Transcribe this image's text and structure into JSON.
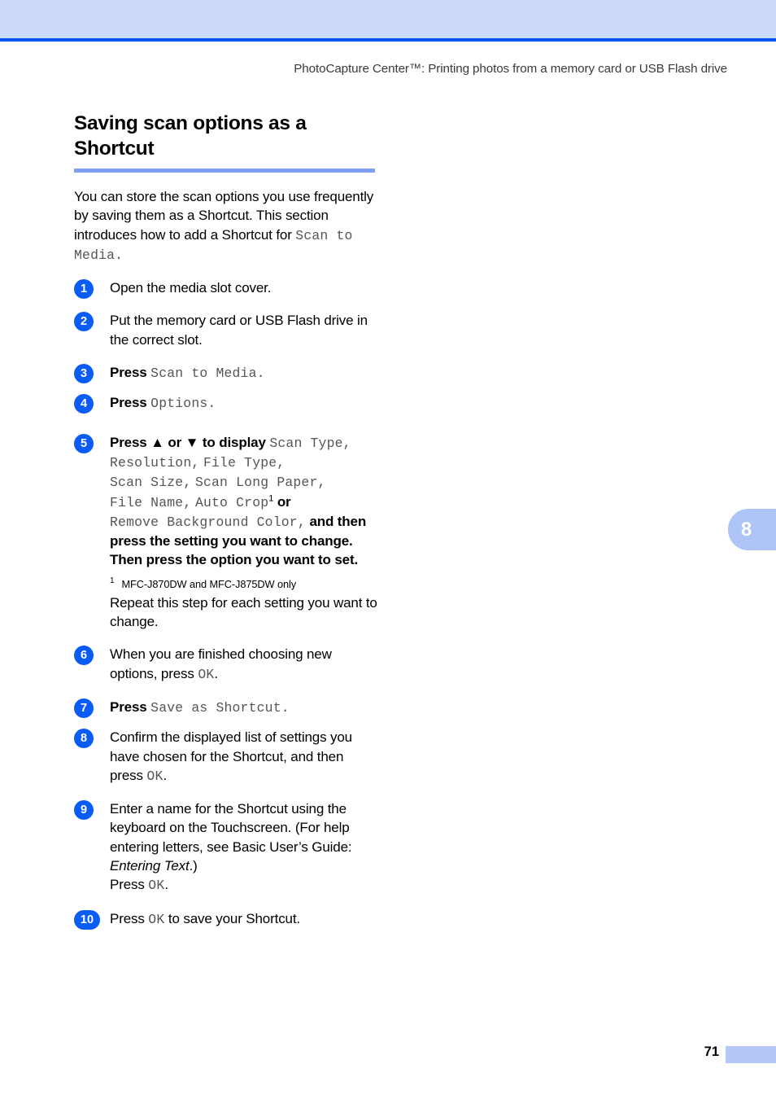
{
  "header": {
    "running_head": "PhotoCapture Center™: Printing photos from a memory card or USB Flash drive",
    "band_color": "#ccd9fb",
    "rule_color": "#0055f0"
  },
  "section": {
    "title": "Saving scan options as a Shortcut",
    "rule_color": "#7e9ff4",
    "intro_text_1": "You can store the scan options you use frequently by saving them as a Shortcut. This section introduces how to add a Shortcut for ",
    "intro_lcd": "Scan to Media."
  },
  "steps": [
    {
      "number": "1",
      "text": "Open the media slot cover."
    },
    {
      "number": "2",
      "text": "Put the memory card or USB Flash drive in the correct slot."
    },
    {
      "number": "3",
      "press_label": "Press",
      "lcd": "Scan to Media."
    },
    {
      "number": "4",
      "press_label": "Press",
      "lcd": "Options."
    },
    {
      "number": "5",
      "lead": "Press ▲ or ▼ to display ",
      "lcd_items": [
        "Scan Type,",
        "Resolution,",
        "File Type,",
        "Scan Size,",
        "Scan Long Paper,",
        "File Name,",
        "Auto Crop",
        "Remove Background Color,"
      ],
      "footnote_marker": "1",
      "or_word": "or",
      "tail": "and then press the setting you want to change. Then press the option you want to set.",
      "footnote_number": "1",
      "footnote_text": "MFC-J870DW and MFC-J875DW only",
      "after_note": "Repeat this step for each setting you want to change."
    },
    {
      "number": "6",
      "text_before": "When you are finished choosing new options, press ",
      "lcd": "OK",
      "text_after": "."
    },
    {
      "number": "7",
      "press_label": "Press",
      "lcd": "Save as Shortcut."
    },
    {
      "number": "8",
      "text_before": "Confirm the displayed list of settings you have chosen for the Shortcut, and then press ",
      "lcd": "OK",
      "text_after": "."
    },
    {
      "number": "9",
      "text_before": "Enter a name for the Shortcut using the keyboard on the Touchscreen. (For help entering letters, see Basic User’s Guide: ",
      "italic": "Entering Text",
      "text_after": ".)",
      "press_line_label": "Press ",
      "press_line_lcd": "OK",
      "press_line_end": "."
    },
    {
      "number": "10",
      "press_label": "Press ",
      "lcd": "OK",
      "text_after": " to save your Shortcut."
    }
  ],
  "chapter_tab": {
    "number": "8",
    "color": "#aec4f6"
  },
  "footer": {
    "page_number": "71",
    "block_color": "#b4c8f7"
  }
}
